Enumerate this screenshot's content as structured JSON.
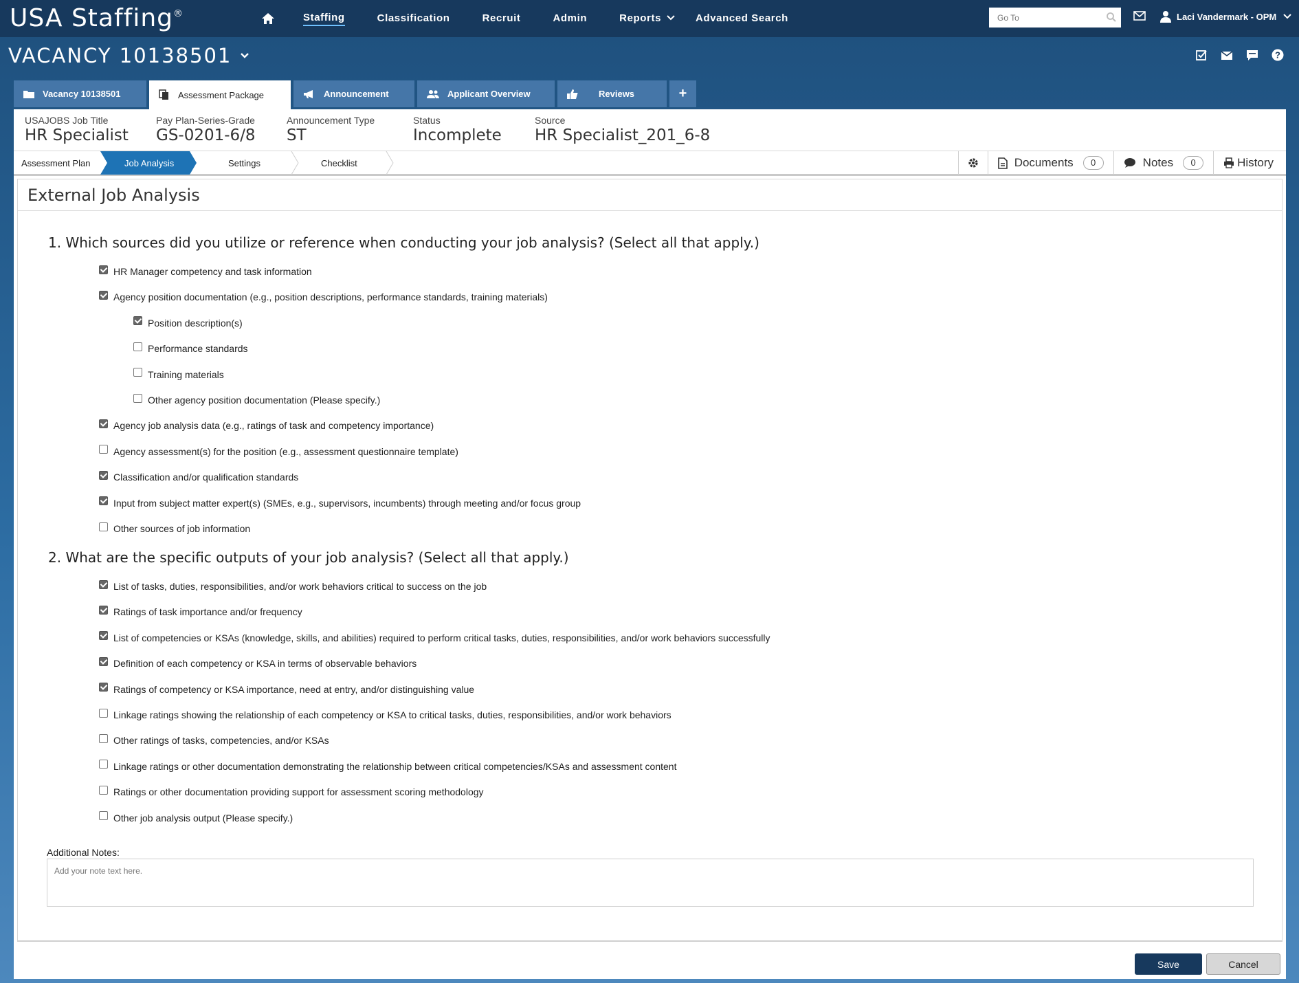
{
  "app": {
    "logo": "USA Staffing",
    "logo_mark": "®"
  },
  "nav": {
    "items": [
      "Staffing",
      "Classification",
      "Recruit",
      "Admin",
      "Reports",
      "Advanced Search"
    ],
    "active": "Staffing",
    "goto_placeholder": "Go To",
    "user": "Laci Vandermark - OPM"
  },
  "vacancy": {
    "title": "VACANCY 10138501"
  },
  "tabs": [
    {
      "label": "Vacancy 10138501",
      "icon": "folder-icon"
    },
    {
      "label": "Assessment Package",
      "icon": "documents-icon",
      "active": true
    },
    {
      "label": "Announcement",
      "icon": "megaphone-icon"
    },
    {
      "label": "Applicant Overview",
      "icon": "users-icon"
    },
    {
      "label": "Reviews",
      "icon": "thumbs-up-icon"
    }
  ],
  "tab_add": "+",
  "info": [
    {
      "label": "USAJOBS Job Title",
      "value": "HR Specialist"
    },
    {
      "label": "Pay Plan-Series-Grade",
      "value": "GS-0201-6/8"
    },
    {
      "label": "Announcement Type",
      "value": "ST"
    },
    {
      "label": "Status",
      "value": "Incomplete"
    },
    {
      "label": "Source",
      "value": "HR Specialist_201_6-8"
    }
  ],
  "subnav": {
    "steps": [
      "Assessment Plan",
      "Job Analysis",
      "Settings",
      "Checklist"
    ],
    "active": "Job Analysis",
    "documents_label": "Documents",
    "documents_count": "0",
    "notes_label": "Notes",
    "notes_count": "0",
    "history_label": "History"
  },
  "section_title": "External Job Analysis",
  "q1": {
    "text": "1. Which sources did you utilize or reference when conducting your job analysis? (Select all that apply.)",
    "options": [
      {
        "label": "HR Manager competency and task information",
        "checked": true,
        "level": 0
      },
      {
        "label": "Agency position documentation (e.g., position descriptions, performance standards, training materials)",
        "checked": true,
        "level": 0
      },
      {
        "label": "Position description(s)",
        "checked": true,
        "level": 1
      },
      {
        "label": "Performance standards",
        "checked": false,
        "level": 1
      },
      {
        "label": "Training materials",
        "checked": false,
        "level": 1
      },
      {
        "label": "Other agency position documentation (Please specify.)",
        "checked": false,
        "level": 1
      },
      {
        "label": "Agency job analysis data (e.g., ratings of task and competency importance)",
        "checked": true,
        "level": 0
      },
      {
        "label": "Agency assessment(s) for the position (e.g., assessment questionnaire template)",
        "checked": false,
        "level": 0
      },
      {
        "label": "Classification and/or qualification standards",
        "checked": true,
        "level": 0
      },
      {
        "label": "Input from subject matter expert(s) (SMEs, e.g., supervisors, incumbents) through meeting and/or focus group",
        "checked": true,
        "level": 0
      },
      {
        "label": "Other sources of job information",
        "checked": false,
        "level": 0
      }
    ]
  },
  "q2": {
    "text": "2. What are the specific outputs of your job analysis? (Select all that apply.)",
    "options": [
      {
        "label": "List of tasks, duties, responsibilities, and/or work behaviors critical to success on the job",
        "checked": true
      },
      {
        "label": "Ratings of task importance and/or frequency",
        "checked": true
      },
      {
        "label": "List of competencies or KSAs (knowledge, skills, and abilities) required to perform critical tasks, duties, responsibilities, and/or work behaviors successfully",
        "checked": true
      },
      {
        "label": "Definition of each competency or KSA in terms of observable behaviors",
        "checked": true
      },
      {
        "label": "Ratings of competency or KSA importance, need at entry, and/or distinguishing value",
        "checked": true
      },
      {
        "label": "Linkage ratings showing the relationship of each competency or KSA to critical tasks, duties, responsibilities, and/or work behaviors",
        "checked": false
      },
      {
        "label": "Other ratings of tasks, competencies, and/or KSAs",
        "checked": false
      },
      {
        "label": "Linkage ratings or other documentation demonstrating the relationship between critical competencies/KSAs and assessment content",
        "checked": false
      },
      {
        "label": "Ratings or other documentation providing support for assessment scoring methodology",
        "checked": false
      },
      {
        "label": "Other job analysis output (Please specify.)",
        "checked": false
      }
    ]
  },
  "notes": {
    "label": "Additional Notes:",
    "placeholder": "Add your note text here."
  },
  "buttons": {
    "save": "Save",
    "cancel": "Cancel"
  }
}
